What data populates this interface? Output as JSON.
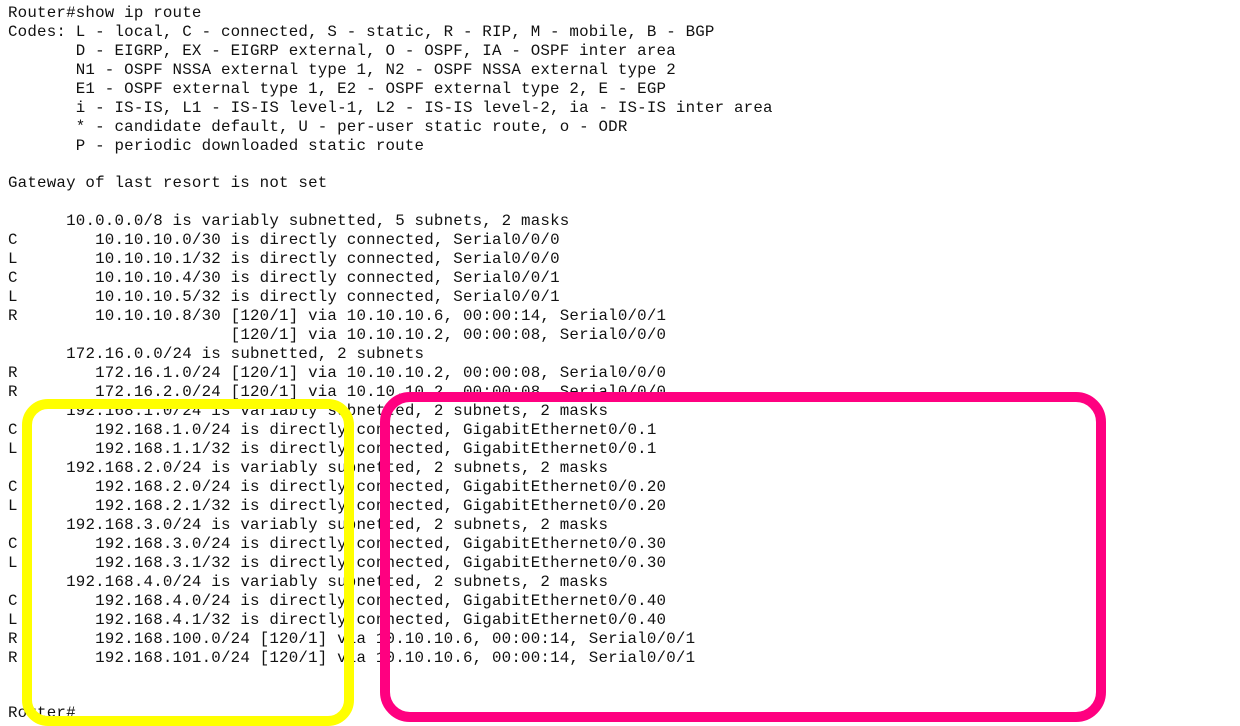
{
  "command": "Router#show ip route",
  "codes": [
    "Codes: L - local, C - connected, S - static, R - RIP, M - mobile, B - BGP",
    "       D - EIGRP, EX - EIGRP external, O - OSPF, IA - OSPF inter area",
    "       N1 - OSPF NSSA external type 1, N2 - OSPF NSSA external type 2",
    "       E1 - OSPF external type 1, E2 - OSPF external type 2, E - EGP",
    "       i - IS-IS, L1 - IS-IS level-1, L2 - IS-IS level-2, ia - IS-IS inter area",
    "       * - candidate default, U - per-user static route, o - ODR",
    "       P - periodic downloaded static route"
  ],
  "gateway": "Gateway of last resort is not set",
  "routes": [
    {
      "code": "",
      "text": "     10.0.0.0/8 is variably subnetted, 5 subnets, 2 masks"
    },
    {
      "code": "C",
      "text": "        10.10.10.0/30 is directly connected, Serial0/0/0"
    },
    {
      "code": "L",
      "text": "        10.10.10.1/32 is directly connected, Serial0/0/0"
    },
    {
      "code": "C",
      "text": "        10.10.10.4/30 is directly connected, Serial0/0/1"
    },
    {
      "code": "L",
      "text": "        10.10.10.5/32 is directly connected, Serial0/0/1"
    },
    {
      "code": "R",
      "text": "        10.10.10.8/30 [120/1] via 10.10.10.6, 00:00:14, Serial0/0/1"
    },
    {
      "code": "",
      "text": "                      [120/1] via 10.10.10.2, 00:00:08, Serial0/0/0"
    },
    {
      "code": "",
      "text": "     172.16.0.0/24 is subnetted, 2 subnets"
    },
    {
      "code": "R",
      "text": "        172.16.1.0/24 [120/1] via 10.10.10.2, 00:00:08, Serial0/0/0"
    },
    {
      "code": "R",
      "text": "        172.16.2.0/24 [120/1] via 10.10.10.2, 00:00:08, Serial0/0/0"
    },
    {
      "code": "",
      "text": "     192.168.1.0/24 is variably subnetted, 2 subnets, 2 masks"
    },
    {
      "code": "C",
      "text": "        192.168.1.0/24 is directly connected, GigabitEthernet0/0.1"
    },
    {
      "code": "L",
      "text": "        192.168.1.1/32 is directly connected, GigabitEthernet0/0.1"
    },
    {
      "code": "",
      "text": "     192.168.2.0/24 is variably subnetted, 2 subnets, 2 masks"
    },
    {
      "code": "C",
      "text": "        192.168.2.0/24 is directly connected, GigabitEthernet0/0.20"
    },
    {
      "code": "L",
      "text": "        192.168.2.1/32 is directly connected, GigabitEthernet0/0.20"
    },
    {
      "code": "",
      "text": "     192.168.3.0/24 is variably subnetted, 2 subnets, 2 masks"
    },
    {
      "code": "C",
      "text": "        192.168.3.0/24 is directly connected, GigabitEthernet0/0.30"
    },
    {
      "code": "L",
      "text": "        192.168.3.1/32 is directly connected, GigabitEthernet0/0.30"
    },
    {
      "code": "",
      "text": "     192.168.4.0/24 is variably subnetted, 2 subnets, 2 masks"
    },
    {
      "code": "C",
      "text": "        192.168.4.0/24 is directly connected, GigabitEthernet0/0.40"
    },
    {
      "code": "L",
      "text": "        192.168.4.1/32 is directly connected, GigabitEthernet0/0.40"
    },
    {
      "code": "R",
      "text": "        192.168.100.0/24 [120/1] via 10.10.10.6, 00:00:14, Serial0/0/1"
    },
    {
      "code": "R",
      "text": "        192.168.101.0/24 [120/1] via 10.10.10.6, 00:00:14, Serial0/0/1"
    }
  ],
  "prompt": "Router#",
  "colors": {
    "highlight_left": "#ffff00",
    "highlight_right": "#ff0080"
  }
}
